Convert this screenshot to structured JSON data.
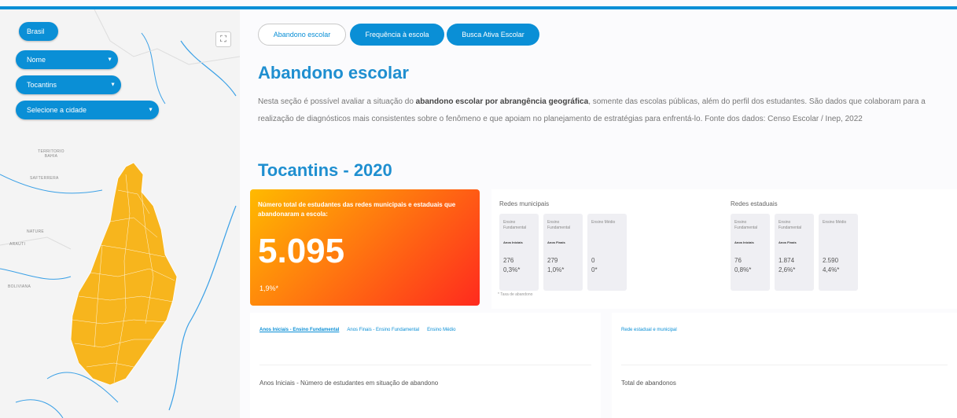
{
  "map": {
    "region_button": "Brasil",
    "name_select": "Nome",
    "state_select": "Tocantins",
    "city_select": "Selecione a cidade",
    "fullscreen_icon": "fullscreen-icon",
    "labels": [
      "TERRITORIO BAHIA",
      "SAFTERRERA",
      "NATURE",
      "ARAUTI",
      "BOLIVIANA"
    ],
    "state_color": "#f7b51d",
    "river_color": "#3aa0e6"
  },
  "tabs": [
    {
      "label": "Abandono escolar",
      "active": false
    },
    {
      "label": "Frequência à escola",
      "active": true
    },
    {
      "label": "Busca Ativa Escolar",
      "active": true
    }
  ],
  "page": {
    "title": "Abandono escolar",
    "description_pre": "Nesta seção é possível avaliar a situação do ",
    "description_bold": "abandono escolar por abrangência geográfica",
    "description_post": ", somente das escolas públicas, além do perfil dos estudantes. São dados que colaboram para a realização de diagnósticos mais consistentes sobre o fenômeno e que apoiam no planejamento de estratégias para enfrentá-lo. Fonte dos dados: Censo Escolar / Inep, 2022",
    "subtitle": "Tocantins - 2020"
  },
  "summary": {
    "label": "Número total de estudantes das redes municipais e estaduais que abandonaram a escola:",
    "total": "5.095",
    "rate": "1,9%*"
  },
  "redes": {
    "municipal": {
      "header": "Redes municipais",
      "items": [
        {
          "cat": "Ensino Fundamental",
          "etapa": "Anos Iniciais",
          "count": "276",
          "rate": "0,3%*"
        },
        {
          "cat": "Ensino Fundamental",
          "etapa": "Anos Finais",
          "count": "279",
          "rate": "1,0%*"
        },
        {
          "cat": "Ensino Médio",
          "etapa": "",
          "count": "0",
          "rate": "0*"
        }
      ]
    },
    "estadual": {
      "header": "Redes estaduais",
      "items": [
        {
          "cat": "Ensino Fundamental",
          "etapa": "Anos Iniciais",
          "count": "76",
          "rate": "0,8%*"
        },
        {
          "cat": "Ensino Fundamental",
          "etapa": "Anos Finais",
          "count": "1.874",
          "rate": "2,6%*"
        },
        {
          "cat": "Ensino Médio",
          "etapa": "",
          "count": "2.590",
          "rate": "4,4%*"
        }
      ]
    },
    "footnote": "* Taxa de abandono"
  },
  "left_panel": {
    "tabs": [
      "Anos Iniciais - Ensino Fundamental",
      "Anos Finais - Ensino Fundamental",
      "Ensino Médio"
    ],
    "title": "Anos Iniciais - Número de estudantes em situação de abandono"
  },
  "right_panel": {
    "tab": "Rede estadual e municipal",
    "title": "Total de abandonos"
  }
}
